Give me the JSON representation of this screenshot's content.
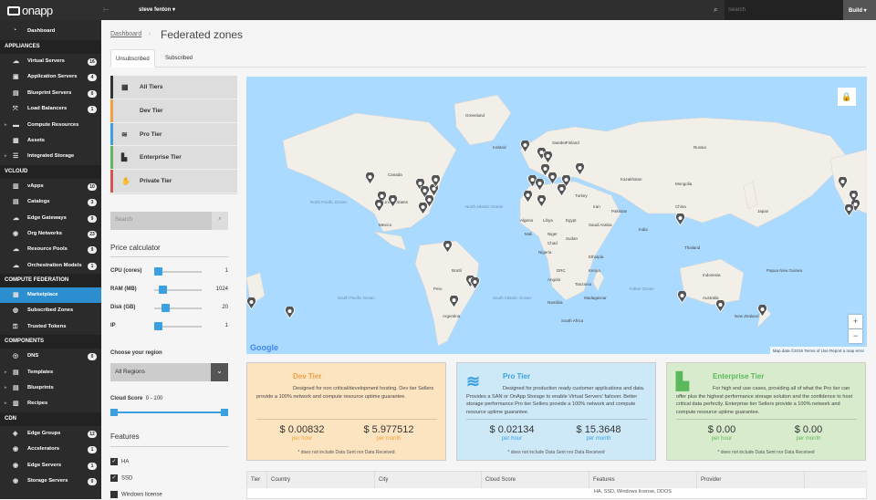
{
  "app": {
    "logo": "onapp",
    "user": "steve fenton ▾",
    "search_placeholder": "Search",
    "build": "Build ▾"
  },
  "sidebar": {
    "dashboard": "Dashboard",
    "sections": [
      {
        "title": "APPLIANCES",
        "items": [
          {
            "label": "Virtual Servers",
            "badge": "16",
            "icon": "cloud-icon"
          },
          {
            "label": "Application Servers",
            "badge": "4",
            "icon": "app-server-icon"
          },
          {
            "label": "Blueprint Servers",
            "badge": "0",
            "icon": "blueprint-icon"
          },
          {
            "label": "Load Balancers",
            "badge": "1",
            "icon": "load-balancer-icon"
          },
          {
            "label": "Compute Resources",
            "badge": "",
            "icon": "server-icon",
            "arrow": true
          },
          {
            "label": "Assets",
            "badge": "",
            "icon": "assets-icon"
          },
          {
            "label": "Integrated Storage",
            "badge": "",
            "icon": "storage-icon",
            "arrow": true
          }
        ]
      },
      {
        "title": "VCLOUD",
        "items": [
          {
            "label": "vApps",
            "badge": "10",
            "icon": "vapp-icon"
          },
          {
            "label": "Catalogs",
            "badge": "3",
            "icon": "catalog-icon"
          },
          {
            "label": "Edge Gateways",
            "badge": "9",
            "icon": "gateway-icon"
          },
          {
            "label": "Org Networks",
            "badge": "23",
            "icon": "network-icon"
          },
          {
            "label": "Resource Pools",
            "badge": "9",
            "icon": "pool-icon"
          },
          {
            "label": "Orchestration Models",
            "badge": "1",
            "icon": "orchestration-icon"
          }
        ]
      },
      {
        "title": "COMPUTE FEDERATION",
        "items": [
          {
            "label": "Marketplace",
            "badge": "",
            "icon": "marketplace-icon",
            "active": true
          },
          {
            "label": "Subscribed Zones",
            "badge": "",
            "icon": "globe-icon"
          },
          {
            "label": "Trusted Tokens",
            "badge": "",
            "icon": "token-icon"
          }
        ]
      },
      {
        "title": "COMPONENTS",
        "items": [
          {
            "label": "DNS",
            "badge": "0",
            "icon": "dns-icon"
          },
          {
            "label": "Templates",
            "badge": "",
            "icon": "templates-icon",
            "arrow": true
          },
          {
            "label": "Blueprints",
            "badge": "",
            "icon": "blueprints-icon",
            "arrow": true
          },
          {
            "label": "Recipes",
            "badge": "",
            "icon": "recipes-icon",
            "arrow": true
          }
        ]
      },
      {
        "title": "CDN",
        "items": [
          {
            "label": "Edge Groups",
            "badge": "12",
            "icon": "edge-group-icon"
          },
          {
            "label": "Accelerators",
            "badge": "1",
            "icon": "accelerator-icon"
          },
          {
            "label": "Edge Servers",
            "badge": "1",
            "icon": "edge-server-icon"
          },
          {
            "label": "Storage Servers",
            "badge": "0",
            "icon": "storage-server-icon"
          }
        ]
      }
    ]
  },
  "main": {
    "breadcrumb": "Dashboard",
    "title": "Federated zones",
    "tabs": [
      "Unsubscribed",
      "Subscribed"
    ],
    "tiers": [
      {
        "label": "All Tiers",
        "color": "#333333",
        "icon": "grid-icon"
      },
      {
        "label": "Dev Tier",
        "color": "#f0a040",
        "icon": "code-icon"
      },
      {
        "label": "Pro Tier",
        "color": "#3aa0e0",
        "icon": "stack-icon"
      },
      {
        "label": "Enterprise Tier",
        "color": "#5cb85c",
        "icon": "building-icon"
      },
      {
        "label": "Private Tier",
        "color": "#d9534f",
        "icon": "hand-icon"
      }
    ],
    "search_placeholder": "Search",
    "price_calc": {
      "title": "Price calculator",
      "rows": [
        {
          "label": "CPU (cores)",
          "value": "1",
          "pos": 0.0
        },
        {
          "label": "RAM (MB)",
          "value": "1024",
          "pos": 0.1
        },
        {
          "label": "Disk (GB)",
          "value": "20",
          "pos": 0.15
        },
        {
          "label": "IP",
          "value": "1",
          "pos": 0.0
        }
      ]
    },
    "region": {
      "title": "Choose your region",
      "selected": "All Regions"
    },
    "cloud_score": {
      "label": "Cloud Score",
      "min": "0",
      "sep": "-",
      "max": "100"
    },
    "features": {
      "title": "Features",
      "items": [
        "HA",
        "SSD",
        "Windows license"
      ]
    },
    "cards": [
      {
        "title": "Dev Tier",
        "color": "#f0a040",
        "bg": "#fde4c0",
        "desc": "Designed for non critical/development hosting. Dev tier Sellers provide a 100% network and compute resource uptime guarantee.",
        "price_hour": "$ 0.00832",
        "price_month": "$ 5.977512",
        "unit_hour": "per hour",
        "unit_month": "per month",
        "note": "* does not include Data Sent nor Data Received",
        "icon": "</>"
      },
      {
        "title": "Pro Tier",
        "color": "#3aa0e0",
        "bg": "#cde9f8",
        "desc": "Designed for production ready customer applications and data. Provides a SAN or OnApp Storage to enable Virtual Servers' failover. Better storage performance Pro tier Sellers provide a 100% network and compute resource uptime guarantee.",
        "price_hour": "$ 0.02134",
        "price_month": "$ 15.3648",
        "unit_hour": "per hour",
        "unit_month": "per month",
        "note": "* does not include Data Sent nor Data Received",
        "icon": "≋"
      },
      {
        "title": "Enterprise Tier",
        "color": "#5cb85c",
        "bg": "#d8eccd",
        "desc": "For high end use cases, providing all of what the Pro tier can offer plus the highest performance storage solution and the confidence to host critical data perfectly. Enterprise tier Sellers provide a 100% network and compute resource uptime guarantee.",
        "price_hour": "$ 0.00",
        "price_month": "$ 0.00",
        "unit_hour": "per hour",
        "unit_month": "per month",
        "note": "* does not include Data Sent nor Data Received",
        "icon": "▙"
      }
    ],
    "map": {
      "footer": "Map data ©2016   Terms of Use   Report a map error",
      "google": "Google",
      "labels": [
        "Greenland",
        "Canada",
        "United States",
        "Mexico",
        "North Pacific Ocean",
        "North Atlantic Ocean",
        "South Atlantic Ocean",
        "South Pacific Ocean",
        "Indian Ocean",
        "Brazil",
        "Peru",
        "Argentina",
        "Algeria",
        "Libya",
        "Egypt",
        "Mali",
        "Niger",
        "Sudan",
        "Chad",
        "Nigeria",
        "Ethiopia",
        "Kenya",
        "DRC",
        "Tanzania",
        "Angola",
        "Namibia",
        "South Africa",
        "Madagascar",
        "Sweden",
        "Finland",
        "Iceland",
        "Kazakhstan",
        "Mongolia",
        "China",
        "India",
        "Iran",
        "Saudi Arabia",
        "Turkey",
        "Pakistan",
        "Thailand",
        "Indonesia",
        "Papua New Guinea",
        "Australia",
        "New Zealand",
        "Japan",
        "Russia"
      ]
    },
    "table": {
      "headers": [
        "Tier",
        "Country",
        "City",
        "Cloud Score",
        "Features",
        "Provider"
      ],
      "row_features": "HA, SSD, Windows license, DDOS"
    }
  }
}
